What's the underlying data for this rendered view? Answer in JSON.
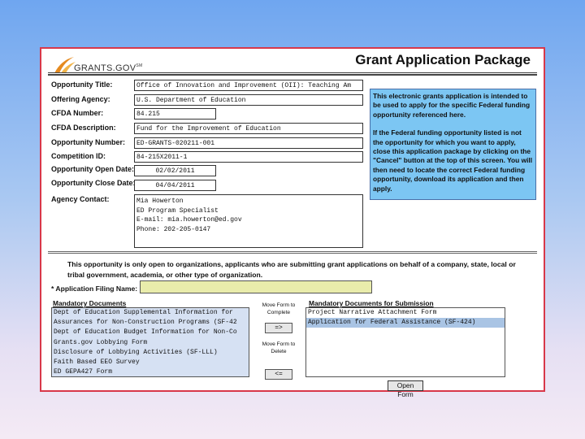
{
  "app": {
    "logo_text": "GRANTS.GOV",
    "logo_tm": "SM",
    "title": "Grant Application Package"
  },
  "form": {
    "opportunity_title": {
      "label": "Opportunity Title:",
      "value": "Office of Innovation and Improvement (OII): Teaching Am"
    },
    "offering_agency": {
      "label": "Offering Agency:",
      "value": "U.S. Department of Education"
    },
    "cfda_number": {
      "label": "CFDA Number:",
      "value": "84.215"
    },
    "cfda_description": {
      "label": "CFDA Description:",
      "value": "Fund for the Improvement of Education"
    },
    "opportunity_number": {
      "label": "Opportunity Number:",
      "value": "ED-GRANTS-020211-001"
    },
    "competition_id": {
      "label": "Competition ID:",
      "value": "84-215X2011-1"
    },
    "open_date": {
      "label": "Opportunity Open Date:",
      "value": "02/02/2011"
    },
    "close_date": {
      "label": "Opportunity Close Date:",
      "value": "04/04/2011"
    },
    "agency_contact": {
      "label": "Agency Contact:",
      "lines": [
        "Mia Howerton",
        "ED Program Specialist",
        "E-mail: mia.howerton@ed.gov",
        "Phone: 202-205-0147"
      ]
    }
  },
  "info_box": {
    "paragraphs": [
      "This electronic grants application is intended to be used to apply for the specific Federal funding opportunity referenced here.",
      "If the Federal funding opportunity listed is not the opportunity for which you want to apply, close this application package by clicking on the \"Cancel\" button at the top of this screen. You will then need to locate the correct Federal funding opportunity, download its application and then apply."
    ]
  },
  "notice": "This opportunity is only open to organizations, applicants who are submitting grant applications on behalf of a company, state, local or tribal government, academia, or other type of organization.",
  "filing": {
    "label": "* Application Filing Name:",
    "value": ""
  },
  "mandatory_documents": {
    "title": "Mandatory Documents",
    "items": [
      "Dept of Education Supplemental Information for",
      "Assurances for Non-Construction Programs (SF-42",
      "Dept of Education Budget Information for Non-Co",
      "Grants.gov Lobbying Form",
      "Disclosure of Lobbying Activities (SF-LLL)",
      "Faith Based EEO Survey",
      "ED GEPA427 Form"
    ]
  },
  "mandatory_submission": {
    "title": "Mandatory Documents for Submission",
    "items": [
      "Project Narrative Attachment Form",
      "Application for Federal Assistance (SF-424)"
    ],
    "selected_index": 1
  },
  "move": {
    "to_complete_label": "Move Form to Complete",
    "to_complete_button": "=>",
    "to_delete_label": "Move Form to Delete",
    "to_delete_button": "<="
  },
  "open_form_button": "Open Form",
  "colors": {
    "frame_border": "#d8384a",
    "info_bg": "#7cc6f3",
    "filing_bg": "#e9ecab",
    "list_bg": "#d6e1f3",
    "selected_bg": "#a9c4e4"
  }
}
